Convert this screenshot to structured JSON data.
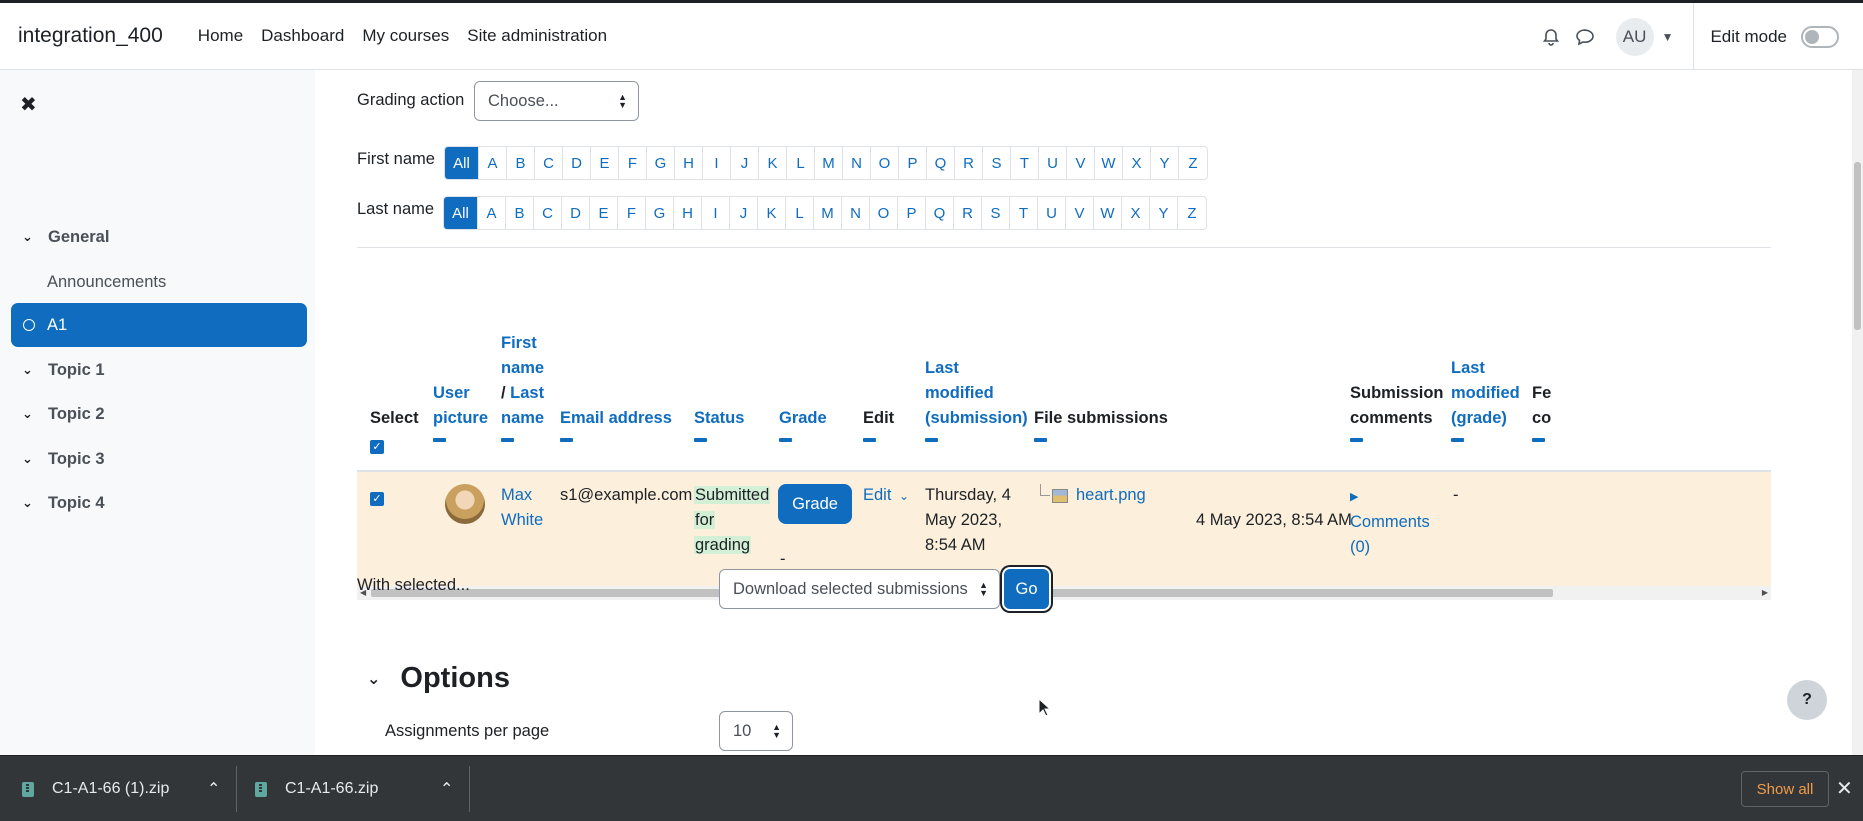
{
  "navbar": {
    "brand": "integration_400",
    "links": [
      "Home",
      "Dashboard",
      "My courses",
      "Site administration"
    ],
    "user_initials": "AU",
    "edit_mode_label": "Edit mode"
  },
  "drawer": {
    "items": [
      {
        "label": "General",
        "kind": "section"
      },
      {
        "label": "Announcements",
        "kind": "sub"
      },
      {
        "label": "A1",
        "kind": "active"
      },
      {
        "label": "Topic 1",
        "kind": "section"
      },
      {
        "label": "Topic 2",
        "kind": "section"
      },
      {
        "label": "Topic 3",
        "kind": "section"
      },
      {
        "label": "Topic 4",
        "kind": "section"
      }
    ]
  },
  "grading": {
    "action_label": "Grading action",
    "action_value": "Choose...",
    "first_name_label": "First name",
    "last_name_label": "Last name",
    "letters": [
      "All",
      "A",
      "B",
      "C",
      "D",
      "E",
      "F",
      "G",
      "H",
      "I",
      "J",
      "K",
      "L",
      "M",
      "N",
      "O",
      "P",
      "Q",
      "R",
      "S",
      "T",
      "U",
      "V",
      "W",
      "X",
      "Y",
      "Z"
    ]
  },
  "table": {
    "headers": {
      "select": "Select",
      "user_picture_1": "User",
      "user_picture_2": "picture",
      "first_name_1": "First",
      "first_name_2": "name",
      "slash": "/ ",
      "last_name_1": "Last",
      "last_name_2": "name",
      "email": "Email address",
      "status": "Status",
      "grade": "Grade",
      "edit": "Edit",
      "last_mod_sub_1": "Last",
      "last_mod_sub_2": "modified",
      "last_mod_sub_3": "(submission)",
      "file_submissions": "File submissions",
      "submission_comments_1": "Submission",
      "submission_comments_2": "comments",
      "last_mod_grade_1": "Last",
      "last_mod_grade_2": "modified",
      "last_mod_grade_3": "(grade)",
      "feedback_1": "Fe",
      "feedback_2": "co"
    },
    "row": {
      "first_name": "Max",
      "last_name": "White",
      "email": "s1@example.com",
      "status_1": "Submitted",
      "status_2": "for",
      "status_3": "grading",
      "grade_button": "Grade",
      "grade_value": "-",
      "edit_label": "Edit",
      "modified_1": "Thursday, 4",
      "modified_2": "May 2023,",
      "modified_3": "8:54 AM",
      "file_name": "heart.png",
      "file_date": "4 May 2023, 8:54 AM",
      "comments_1": "Comments",
      "comments_2": "(0)",
      "last_modified_grade": "-"
    }
  },
  "bulk": {
    "label": "With selected...",
    "select_value": "Download selected submissions",
    "go_button": "Go"
  },
  "options": {
    "heading": "Options",
    "per_page_label": "Assignments per page",
    "per_page_value": "10"
  },
  "help_label": "?",
  "downloads": {
    "items": [
      "C1-A1-66 (1).zip",
      "C1-A1-66.zip"
    ],
    "show_all": "Show all"
  },
  "colors": {
    "primary": "#0f6cbf",
    "row_highlight": "#fcefdc",
    "status_bg": "#d3f0d6",
    "download_bar": "#323639",
    "show_all_text": "#f29b4a"
  }
}
